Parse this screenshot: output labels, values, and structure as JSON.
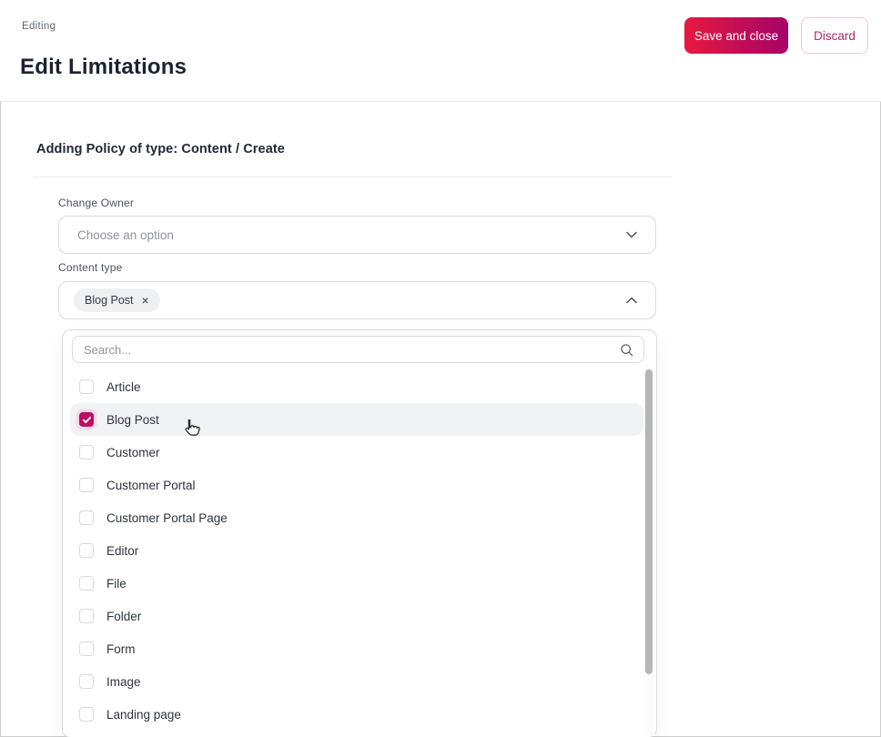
{
  "header": {
    "eyebrow": "Editing",
    "title": "Edit Limitations",
    "save_label": "Save and close",
    "discard_label": "Discard"
  },
  "form": {
    "section_title": "Adding Policy of type: Content / Create",
    "change_owner": {
      "label": "Change Owner",
      "placeholder": "Choose an option"
    },
    "content_type": {
      "label": "Content type",
      "selected_chips": [
        {
          "label": "Blog Post",
          "remove_icon": "×"
        }
      ]
    },
    "dropdown": {
      "search_placeholder": "Search...",
      "options": [
        {
          "label": "Article",
          "checked": false,
          "highlighted": false
        },
        {
          "label": "Blog Post",
          "checked": true,
          "highlighted": true
        },
        {
          "label": "Customer",
          "checked": false,
          "highlighted": false
        },
        {
          "label": "Customer Portal",
          "checked": false,
          "highlighted": false
        },
        {
          "label": "Customer Portal Page",
          "checked": false,
          "highlighted": false
        },
        {
          "label": "Editor",
          "checked": false,
          "highlighted": false
        },
        {
          "label": "File",
          "checked": false,
          "highlighted": false
        },
        {
          "label": "Folder",
          "checked": false,
          "highlighted": false
        },
        {
          "label": "Form",
          "checked": false,
          "highlighted": false
        },
        {
          "label": "Image",
          "checked": false,
          "highlighted": false
        },
        {
          "label": "Landing page",
          "checked": false,
          "highlighted": false
        }
      ]
    }
  },
  "colors": {
    "accent_gradient_start": "#e61a3f",
    "accent_gradient_end": "#a50369",
    "checkbox_checked": "#bc0e63",
    "discard_text": "#b2256b",
    "highlight_row": "#f1f2f4",
    "title_text": "#1b2230",
    "border": "#d9dbde"
  }
}
